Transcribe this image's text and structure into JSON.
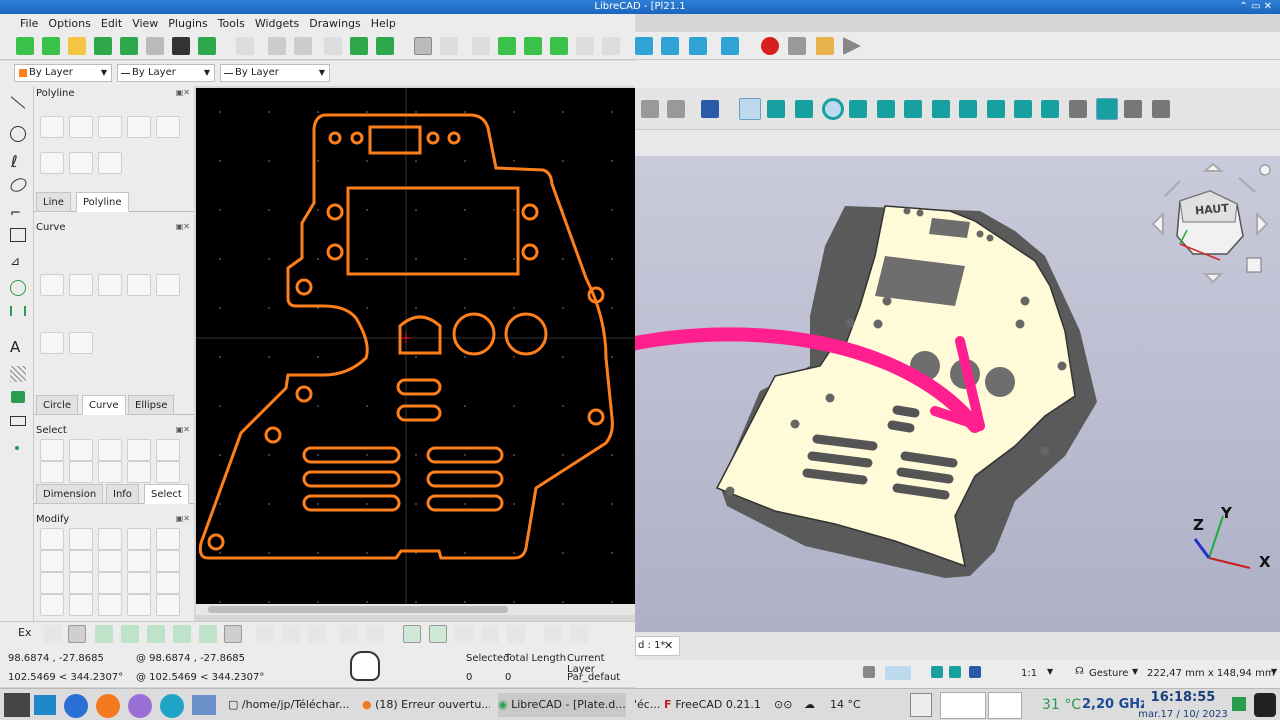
{
  "window": {
    "title": "LibreCAD - [Pl21.1"
  },
  "menu": [
    "File",
    "Options",
    "Edit",
    "View",
    "Plugins",
    "Tools",
    "Widgets",
    "Drawings",
    "Help"
  ],
  "layer_combos": {
    "color": "By Layer",
    "width": "By Layer",
    "linetype": "By Layer"
  },
  "dock": {
    "polyline_title": "Polyline",
    "curve_title": "Curve",
    "select_title": "Select",
    "modify_title": "Modify",
    "tabs1": [
      "Line",
      "Polyline"
    ],
    "tabs2": [
      "Circle",
      "Curve",
      "Ellipse"
    ],
    "tabs3": [
      "Dimension",
      "Info",
      "Select"
    ]
  },
  "snap": {
    "label": "Ex"
  },
  "statusbar": {
    "coord_abs": "98.6874 , -27.8685",
    "coord_rel": "@ 98.6874 , -27.8685",
    "polar_abs": "102.5469 < 344.2307°",
    "polar_rel": "@ 102.5469 < 344.2307°",
    "selected_label": "Selected",
    "total_length_label": "Total Length",
    "current_layer_label": "Current Layer",
    "selected_value": "0",
    "total_length_value": "0",
    "current_layer_value": "Par_defaut"
  },
  "freecad": {
    "tab_label": "d : 1*",
    "nav_cube": "HAUT",
    "axis_x": "X",
    "axis_y": "Y",
    "axis_z": "Z",
    "scale": "1:1",
    "nav_style": "Gesture",
    "dimensions": "222,47 mm x 148,94 mm"
  },
  "taskbar": {
    "t1": "/home/jp/Téléchar...",
    "t2": "(18) Erreur ouvertu...",
    "t3": "LibreCAD - [Plate.d...",
    "t4": "'éc...",
    "t5": "FreeCAD 0.21.1",
    "weather": "14 °C",
    "cpu_temp": "31 °C",
    "cpu_freq": "2,20 GHz",
    "clock_time": "16:18:55",
    "clock_date": "mar.17 / 10/ 2023"
  },
  "colors": {
    "accent": "#ff7f1a",
    "arrow": "#ff1f8e",
    "plate": "#fffbd9",
    "selected_icon": "#1aa34a"
  }
}
